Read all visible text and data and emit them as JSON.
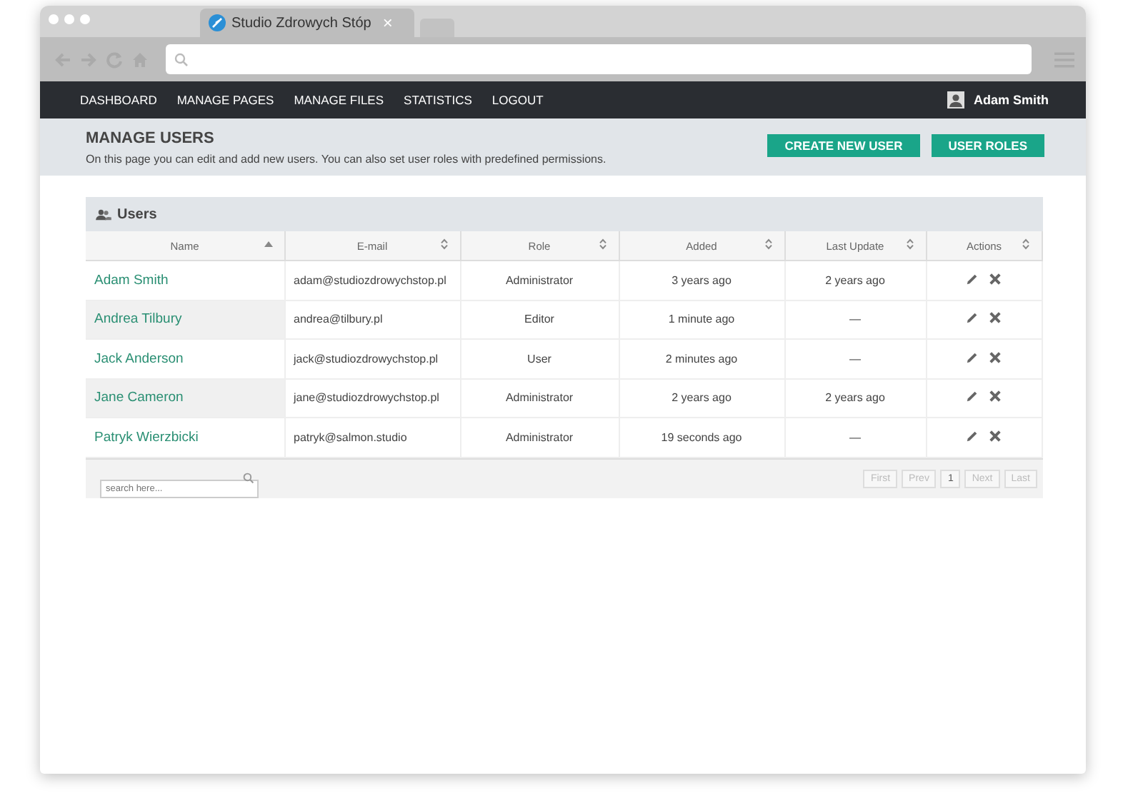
{
  "browser": {
    "tab_title": "Studio Zdrowych Stóp",
    "tab_close": "×"
  },
  "nav": {
    "items": [
      {
        "label": "DASHBOARD"
      },
      {
        "label": "MANAGE PAGES"
      },
      {
        "label": "MANAGE FILES"
      },
      {
        "label": "STATISTICS"
      },
      {
        "label": "LOGOUT"
      }
    ],
    "user": "Adam Smith"
  },
  "header": {
    "title": "MANAGE USERS",
    "description": "On this page you can edit and add new users. You can also set user roles with predefined permissions.",
    "buttons": [
      "CREATE NEW USER",
      "USER ROLES"
    ]
  },
  "panel": {
    "title": "Users"
  },
  "table": {
    "columns": [
      {
        "label": "Name",
        "sorted": true
      },
      {
        "label": "E-mail",
        "sorted": false
      },
      {
        "label": "Role",
        "sorted": false
      },
      {
        "label": "Added",
        "sorted": false
      },
      {
        "label": "Last Update",
        "sorted": false
      },
      {
        "label": "Actions",
        "sorted": false
      }
    ],
    "rows": [
      {
        "name": "Adam Smith",
        "email": "adam@studiozdrowychstop.pl",
        "role": "Administrator",
        "added": "3 years ago",
        "updated": "2 years ago"
      },
      {
        "name": "Andrea Tilbury",
        "email": "andrea@tilbury.pl",
        "role": "Editor",
        "added": "1 minute ago",
        "updated": "—"
      },
      {
        "name": "Jack Anderson",
        "email": "jack@studiozdrowychstop.pl",
        "role": "User",
        "added": "2 minutes ago",
        "updated": "—"
      },
      {
        "name": "Jane Cameron",
        "email": "jane@studiozdrowychstop.pl",
        "role": "Administrator",
        "added": "2 years ago",
        "updated": "2 years ago"
      },
      {
        "name": "Patryk Wierzbicki",
        "email": "patryk@salmon.studio",
        "role": "Administrator",
        "added": "19 seconds ago",
        "updated": "—"
      }
    ]
  },
  "footer": {
    "search_placeholder": "search here...",
    "pagination": [
      {
        "label": "First",
        "disabled": true
      },
      {
        "label": "Prev",
        "disabled": true
      },
      {
        "label": "1",
        "disabled": false
      },
      {
        "label": "Next",
        "disabled": true
      },
      {
        "label": "Last",
        "disabled": true
      }
    ]
  }
}
